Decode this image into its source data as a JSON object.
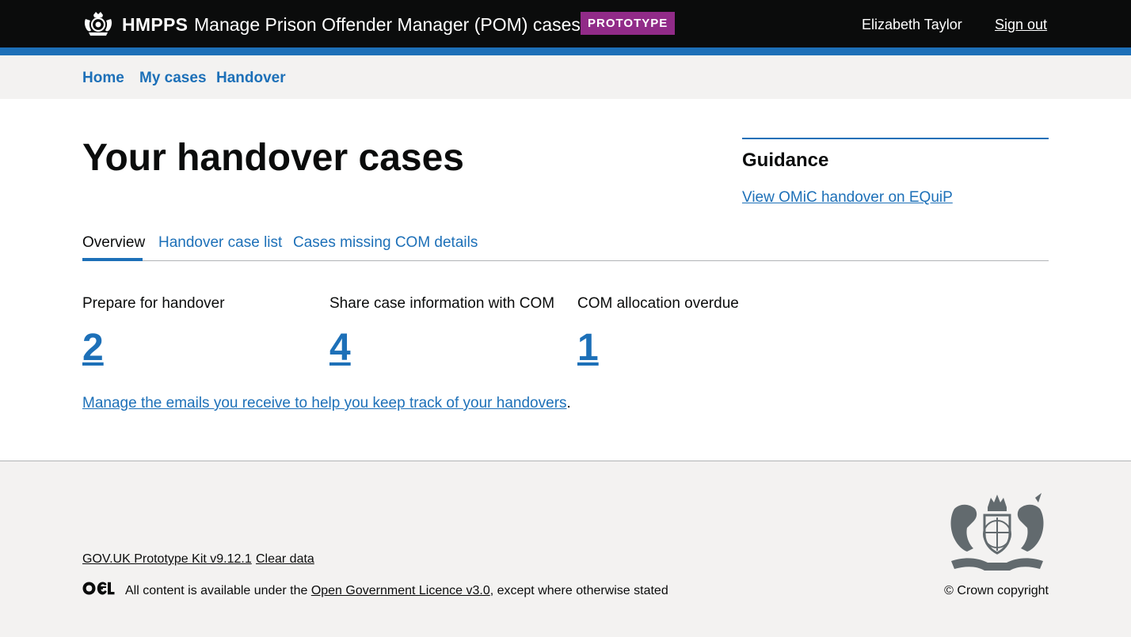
{
  "header": {
    "org": "HMPPS",
    "service": "Manage Prison Offender Manager (POM) cases",
    "tag": "PROTOTYPE",
    "user_name": "Elizabeth Taylor",
    "sign_out": "Sign out",
    "colors": {
      "background": "#0b0c0c",
      "bar": "#1d70b8",
      "tag": "#912b88"
    }
  },
  "nav": {
    "items": [
      {
        "label": "Home"
      },
      {
        "label": "My cases"
      },
      {
        "label": "Handover"
      }
    ]
  },
  "main": {
    "title": "Your handover cases",
    "guidance": {
      "title": "Guidance",
      "link": "View OMiC handover on EQuiP"
    },
    "tabs": [
      {
        "label": "Overview",
        "selected": true
      },
      {
        "label": "Handover case list",
        "selected": false
      },
      {
        "label": "Cases missing COM details",
        "selected": false
      }
    ],
    "stats": [
      {
        "label": "Prepare for handover",
        "value": "2"
      },
      {
        "label": "Share case information with COM",
        "value": "4"
      },
      {
        "label": "COM allocation overdue",
        "value": "1"
      }
    ],
    "email_link": "Manage the emails you receive to help you keep track of your handovers",
    "email_suffix": "."
  },
  "footer": {
    "links": [
      {
        "label": "GOV.UK Prototype Kit v9.12.1"
      },
      {
        "label": "Clear data"
      }
    ],
    "licence_prefix": "All content is available under the ",
    "licence_link": "Open Government Licence v3.0",
    "licence_suffix": ", except where otherwise stated",
    "copyright": "© Crown copyright"
  },
  "icons": [
    "crest-icon",
    "ogl-logo-icon",
    "royal-coat-of-arms-icon"
  ],
  "colors": {
    "link": "#1d70b8",
    "text": "#0b0c0c",
    "nav_bg": "#f3f2f1",
    "border": "#b1b4b6"
  }
}
